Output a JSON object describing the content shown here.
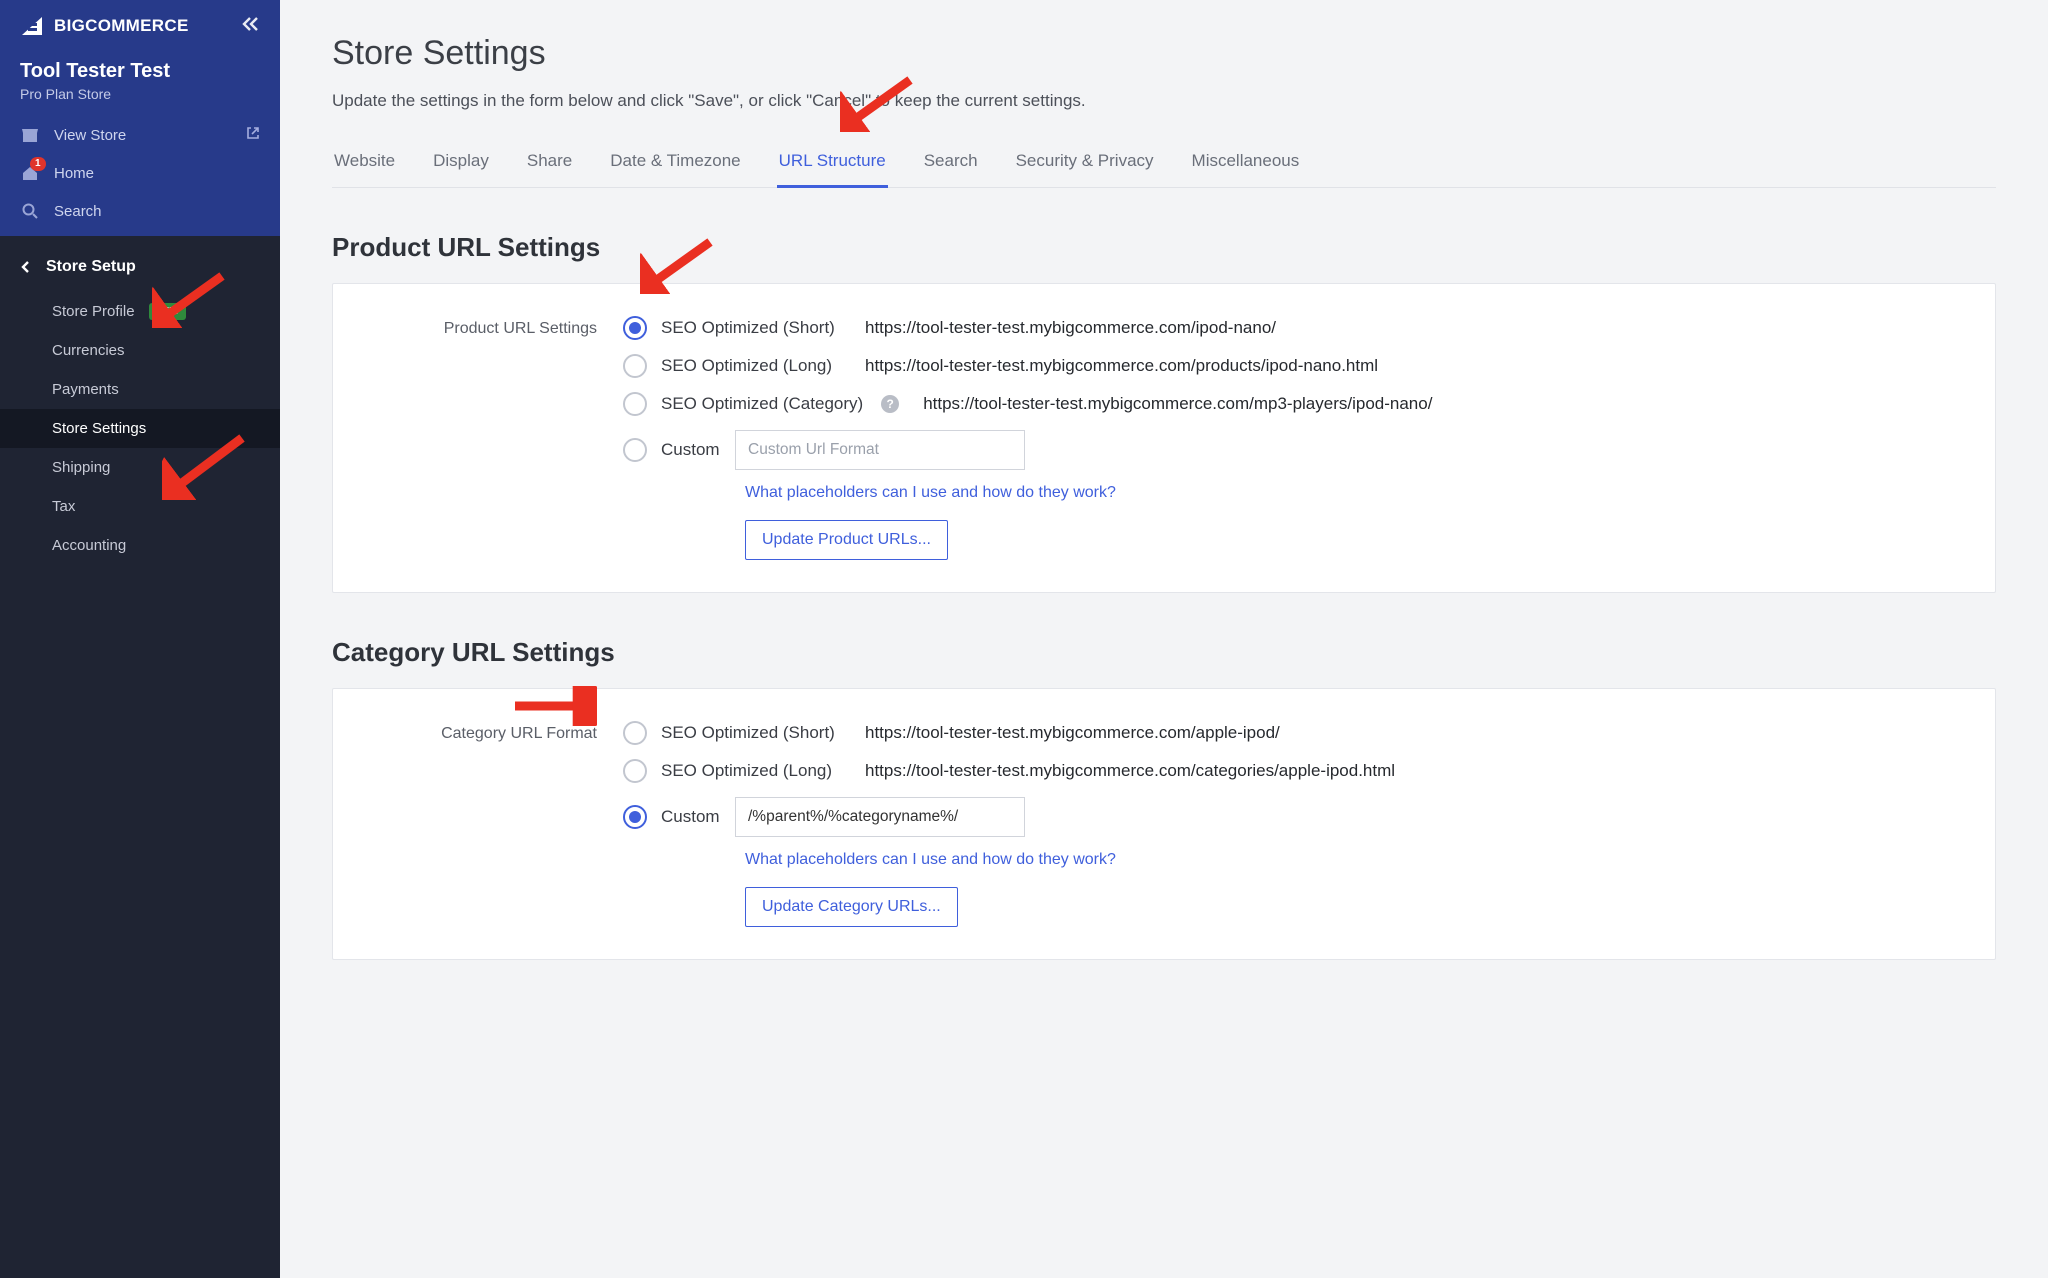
{
  "brand": {
    "name_b": "BIG",
    "name_c": "COMMERCE"
  },
  "store": {
    "name": "Tool Tester Test",
    "plan": "Pro Plan Store"
  },
  "sidebar_top": {
    "view_store": "View Store",
    "home": "Home",
    "home_badge": "1",
    "search": "Search"
  },
  "sidebar_group": {
    "title": "Store Setup",
    "items": [
      {
        "label": "Store Profile",
        "new": true,
        "active": false
      },
      {
        "label": "Currencies",
        "new": false,
        "active": false
      },
      {
        "label": "Payments",
        "new": false,
        "active": false
      },
      {
        "label": "Store Settings",
        "new": false,
        "active": true
      },
      {
        "label": "Shipping",
        "new": false,
        "active": false
      },
      {
        "label": "Tax",
        "new": false,
        "active": false
      },
      {
        "label": "Accounting",
        "new": false,
        "active": false
      }
    ],
    "new_pill": "NEW"
  },
  "page": {
    "title": "Store Settings",
    "subtitle": "Update the settings in the form below and click \"Save\", or click \"Cancel\" to keep the current settings."
  },
  "tabs": [
    {
      "label": "Website",
      "active": false
    },
    {
      "label": "Display",
      "active": false
    },
    {
      "label": "Share",
      "active": false
    },
    {
      "label": "Date & Timezone",
      "active": false
    },
    {
      "label": "URL Structure",
      "active": true
    },
    {
      "label": "Search",
      "active": false
    },
    {
      "label": "Security & Privacy",
      "active": false
    },
    {
      "label": "Miscellaneous",
      "active": false
    }
  ],
  "product_section": {
    "heading": "Product URL Settings",
    "label": "Product URL Settings",
    "options": [
      {
        "label": "SEO Optimized (Short)",
        "checked": true,
        "example": "https://tool-tester-test.mybigcommerce.com/ipod-nano/",
        "help": false
      },
      {
        "label": "SEO Optimized (Long)",
        "checked": false,
        "example": "https://tool-tester-test.mybigcommerce.com/products/ipod-nano.html",
        "help": false
      },
      {
        "label": "SEO Optimized (Category)",
        "checked": false,
        "example": "https://tool-tester-test.mybigcommerce.com/mp3-players/ipod-nano/",
        "help": true
      },
      {
        "label": "Custom",
        "checked": false,
        "example": "",
        "help": false
      }
    ],
    "custom_placeholder": "Custom Url Format",
    "custom_value": "",
    "placeholders_link": "What placeholders can I use and how do they work?",
    "update_button": "Update Product URLs..."
  },
  "category_section": {
    "heading": "Category URL Settings",
    "label": "Category URL Format",
    "options": [
      {
        "label": "SEO Optimized (Short)",
        "checked": false,
        "example": "https://tool-tester-test.mybigcommerce.com/apple-ipod/"
      },
      {
        "label": "SEO Optimized (Long)",
        "checked": false,
        "example": "https://tool-tester-test.mybigcommerce.com/categories/apple-ipod.html"
      },
      {
        "label": "Custom",
        "checked": true,
        "example": ""
      }
    ],
    "custom_value": "/%parent%/%categoryname%/",
    "placeholders_link": "What placeholders can I use and how do they work?",
    "update_button": "Update Category URLs..."
  }
}
